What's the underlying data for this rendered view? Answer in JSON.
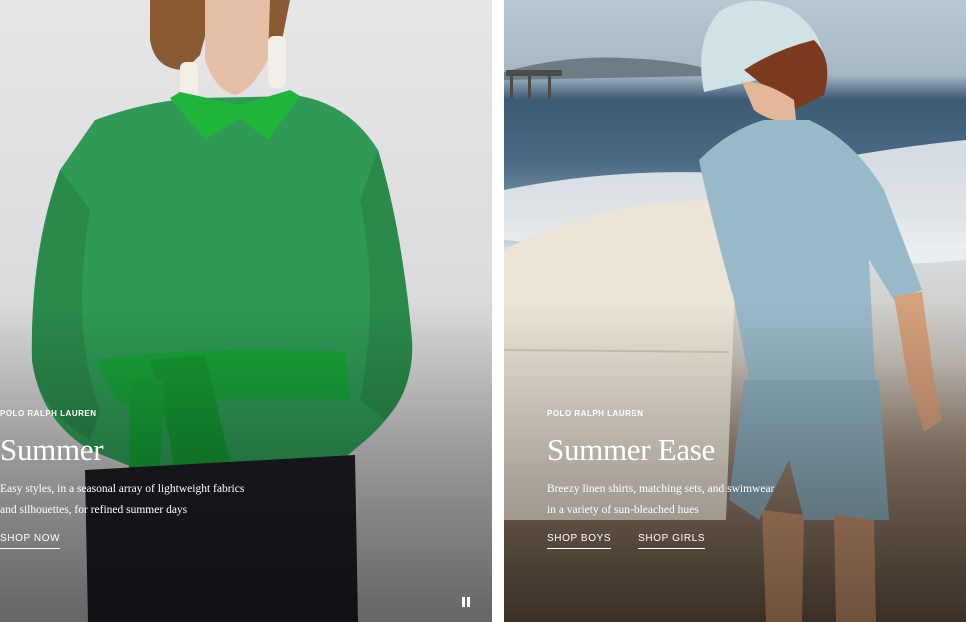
{
  "panels": [
    {
      "brand": "POLO RALPH LAUREN",
      "headline": "Summer",
      "description_line1": "Easy styles, in a seasonal array of lightweight fabrics",
      "description_line2": "and silhouettes, for refined summer days",
      "ctas": [
        "SHOP NOW"
      ],
      "image": "woman in green sweatshirt with cable-knit sweater tied at waist"
    },
    {
      "brand": "POLO RALPH LAUREN",
      "headline": "Summer Ease",
      "description_line1": "Breezy linen shirts, matching sets, and swimwear",
      "description_line2": "in a variety of sun-bleached hues",
      "ctas": [
        "SHOP BOYS",
        "SHOP GIRLS"
      ],
      "image": "boy in light blue linen set holding surfboard on beach"
    }
  ],
  "controls": {
    "pause_icon": "pause-icon"
  },
  "colors": {
    "text": "#ffffff",
    "sweater_green": "#2f9a55",
    "collar_green": "#1fb53a",
    "linen_blue": "#9ab9c8"
  }
}
